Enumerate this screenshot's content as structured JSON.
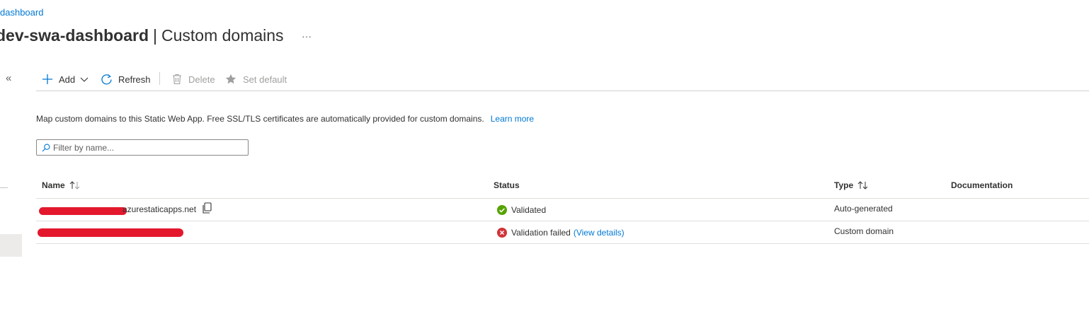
{
  "breadcrumb": {
    "label": "dashboard"
  },
  "header": {
    "resource_name": "dev-swa-dashboard",
    "separator": "|",
    "page_name": "Custom domains",
    "more_label": "···"
  },
  "sidebar": {
    "collapse_label": "«"
  },
  "toolbar": {
    "add_label": "Add",
    "refresh_label": "Refresh",
    "delete_label": "Delete",
    "set_default_label": "Set default"
  },
  "description": {
    "text": "Map custom domains to this Static Web App. Free SSL/TLS certificates are automatically provided for custom domains.",
    "learn_more": "Learn more"
  },
  "filter": {
    "placeholder": "Filter by name..."
  },
  "table": {
    "columns": {
      "name": "Name",
      "status": "Status",
      "type": "Type",
      "documentation": "Documentation"
    },
    "rows": [
      {
        "name": "azurestaticapps.net",
        "status": "Validated",
        "status_kind": "success",
        "type": "Auto-generated"
      },
      {
        "name": "",
        "status": "Validation failed",
        "status_link": "(View details)",
        "status_kind": "error",
        "type": "Custom domain"
      }
    ]
  },
  "colors": {
    "accent": "#0078d4",
    "success": "#57a300",
    "error": "#d13438",
    "redaction": "#e3182d"
  },
  "icons": [
    "add-icon",
    "chevron-down-icon",
    "refresh-icon",
    "delete-icon",
    "star-icon",
    "search-icon",
    "copy-icon",
    "sort-icon",
    "check-circle-icon",
    "error-circle-icon"
  ]
}
